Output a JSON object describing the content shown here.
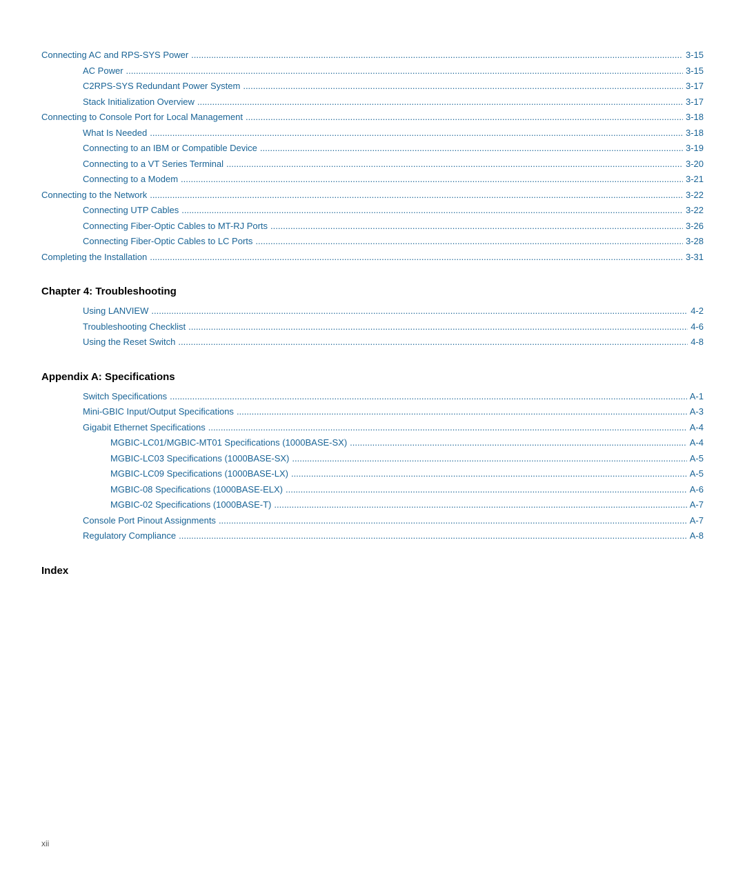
{
  "toc": {
    "sections": [
      {
        "type": "entries",
        "items": [
          {
            "label": "Connecting AC and RPS-SYS Power",
            "page": "3-15",
            "indent": 0
          },
          {
            "label": "AC Power",
            "page": "3-15",
            "indent": 1
          },
          {
            "label": "C2RPS-SYS Redundant Power System",
            "page": "3-17",
            "indent": 1
          },
          {
            "label": "Stack Initialization Overview",
            "page": "3-17",
            "indent": 1
          },
          {
            "label": "Connecting to Console Port for Local Management",
            "page": "3-18",
            "indent": 0
          },
          {
            "label": "What Is Needed",
            "page": "3-18",
            "indent": 1
          },
          {
            "label": "Connecting to an IBM or Compatible Device",
            "page": "3-19",
            "indent": 1
          },
          {
            "label": "Connecting to a VT Series Terminal",
            "page": "3-20",
            "indent": 1
          },
          {
            "label": "Connecting to a Modem",
            "page": "3-21",
            "indent": 1
          },
          {
            "label": "Connecting to the Network",
            "page": "3-22",
            "indent": 0
          },
          {
            "label": "Connecting UTP Cables",
            "page": "3-22",
            "indent": 1
          },
          {
            "label": "Connecting Fiber-Optic Cables to MT-RJ Ports",
            "page": "3-26",
            "indent": 1
          },
          {
            "label": "Connecting Fiber-Optic Cables to LC Ports",
            "page": "3-28",
            "indent": 1
          },
          {
            "label": "Completing the Installation",
            "page": "3-31",
            "indent": 0
          }
        ]
      },
      {
        "type": "header",
        "label": "Chapter 4: Troubleshooting"
      },
      {
        "type": "entries",
        "items": [
          {
            "label": "Using LANVIEW",
            "page": "4-2",
            "indent": 1
          },
          {
            "label": "Troubleshooting Checklist",
            "page": "4-6",
            "indent": 1
          },
          {
            "label": "Using the Reset Switch",
            "page": "4-8",
            "indent": 1
          }
        ]
      },
      {
        "type": "header",
        "label": "Appendix A: Specifications"
      },
      {
        "type": "entries",
        "items": [
          {
            "label": "Switch Specifications",
            "page": "A-1",
            "indent": 1
          },
          {
            "label": "Mini-GBIC Input/Output Specifications",
            "page": "A-3",
            "indent": 1
          },
          {
            "label": "Gigabit Ethernet Specifications",
            "page": "A-4",
            "indent": 1
          },
          {
            "label": "MGBIC-LC01/MGBIC-MT01 Specifications (1000BASE-SX)",
            "page": "A-4",
            "indent": 2
          },
          {
            "label": "MGBIC-LC03 Specifications (1000BASE-SX)",
            "page": "A-5",
            "indent": 2
          },
          {
            "label": "MGBIC-LC09 Specifications (1000BASE-LX)",
            "page": "A-5",
            "indent": 2
          },
          {
            "label": "MGBIC-08 Specifications (1000BASE-ELX)",
            "page": "A-6",
            "indent": 2
          },
          {
            "label": "MGBIC-02 Specifications (1000BASE-T)",
            "page": "A-7",
            "indent": 2
          },
          {
            "label": "Console Port Pinout Assignments",
            "page": "A-7",
            "indent": 1
          },
          {
            "label": "Regulatory Compliance",
            "page": "A-8",
            "indent": 1
          }
        ]
      },
      {
        "type": "header",
        "label": "Index"
      }
    ],
    "footer_page": "xii"
  }
}
